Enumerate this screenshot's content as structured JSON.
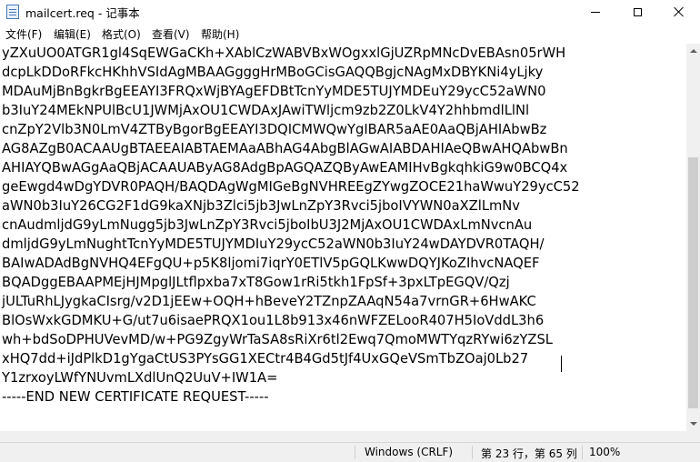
{
  "window": {
    "title": "mailcert.req - 记事本",
    "icon": "notepad-icon",
    "controls": [
      "minimize-icon",
      "maximize-icon",
      "close-icon"
    ]
  },
  "menu": [
    {
      "label": "文件(F)"
    },
    {
      "label": "编辑(E)"
    },
    {
      "label": "格式(O)"
    },
    {
      "label": "查看(V)"
    },
    {
      "label": "帮助(H)"
    }
  ],
  "editor": {
    "lines": [
      "yZXuUO0ATGR1gl4SqEWGaCKh+XAblCzWABVBxWOgxxlGjUZRpMNcDvEBAsn05rWH",
      "dcpLkDDoRFkcHKhhVSIdAgMBAAGgggHrMBoGCisGAQQBgjcNAgMxDBYKNi4yLjky",
      "MDAuMjBnBgkrBgEEAYI3FRQxWjBYAgEFDBtTcnYyMDE5TUJYMDEuY29ycC52aWN0",
      "b3IuY24MEkNPUlBcU1JWMjAxOU1CWDAxJAwiTWljcm9zb2Z0LkV4Y2hhbmdlLlNl",
      "cnZpY2Vlb3N0LmV4ZTByBgorBgEEAYI3DQICMWQwYgIBAR5aAE0AaQBjAHIAbwBz",
      "AG8AZgB0ACAAUgBTAEEAIABTAEMAaABhAG4AbgBlAGwAIABDAHIAeQBwAHQAbwBn",
      "AHIAYQBwAGgAaQBjACAAUAByAG8AdgBpAGQAZQByAwEAMIHvBgkqhkiG9w0BCQ4x",
      "geEwgd4wDgYDVR0PAQH/BAQDAgWgMIGeBgNVHREEgZYwgZOCE21haWwuY29ycC52",
      "aWN0b3IuY26CG2F1dG9kaXNjb3Zlci5jb3JwLnZpY3Rvci5jboIVYWN0aXZlLmNv",
      "cnAudmljdG9yLmNugg5jb3JwLnZpY3Rvci5jboIbU3J2MjAxOU1CWDAxLmNvcnAu",
      "dmljdG9yLmNughtTcnYyMDE5TUJYMDIuY29ycC52aWN0b3IuY24wDAYDVR0TAQH/",
      "BAIwADAdBgNVHQ4EFgQU+p5K8ljomi7iqrY0ETlV5pGQLKwwDQYJKoZIhvcNAQEF",
      "BQADggEBAAPMEjHJMpglJLtflpxba7xT8Gow1rRi5tkh1FpSf+3pxLTpEGQV/Qzj",
      "jULTuRhLJygkaCIsrg/v2D1jEEw+OQH+hBeveY2TZnpZAAqN54a7vrnGR+6HwAKC",
      "BlOsWxkGDMKU+G/ut7u6isaePRQX1ou1L8b913x46nWFZELooR407H5IoVddL3h6",
      "wh+bdSoDPHUVevMD/w+PG9ZgyWrTaSA8sRiXr6tl2Ewq7QmoMWTYqzRYwi6zYZSL",
      "xHQ7dd+iJdPlkD1gYgaCtUS3PYsGG1XECtr4B4Gd5tJf4UxGQeVSmTbZOaj0Lb27",
      "Y1zrxoyLWfYNUvmLXdlUnQ2UuV+IW1A=",
      "-----END NEW CERTIFICATE REQUEST-----"
    ]
  },
  "status": {
    "encoding": "Windows (CRLF)",
    "position": "第 23 行，第 65 列",
    "zoom": "100%"
  }
}
